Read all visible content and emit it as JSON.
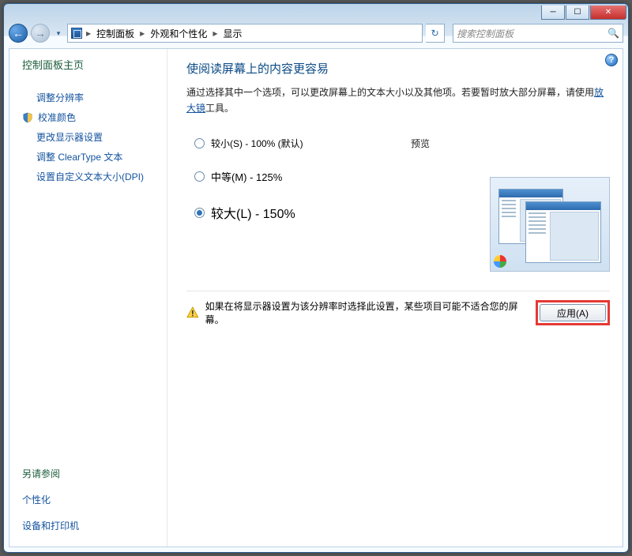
{
  "titlebar": {
    "minimize": "─",
    "maximize": "☐",
    "close": "✕"
  },
  "addressbar": {
    "nav_back": "←",
    "nav_fwd": "→",
    "segments": [
      "控制面板",
      "外观和个性化",
      "显示"
    ],
    "search_placeholder": "搜索控制面板"
  },
  "sidebar": {
    "home": "控制面板主页",
    "links": [
      {
        "label": "调整分辨率",
        "shield": false
      },
      {
        "label": "校准颜色",
        "shield": true
      },
      {
        "label": "更改显示器设置",
        "shield": false
      },
      {
        "label": "调整 ClearType 文本",
        "shield": false
      },
      {
        "label": "设置自定义文本大小(DPI)",
        "shield": false
      }
    ],
    "see_also_title": "另请参阅",
    "see_also": [
      "个性化",
      "设备和打印机"
    ]
  },
  "main": {
    "heading": "使阅读屏幕上的内容更容易",
    "desc_prefix": "通过选择其中一个选项，可以更改屏幕上的文本大小以及其他项。若要暂时放大部分屏幕，请使用",
    "desc_link": "放大镜",
    "desc_suffix": "工具。",
    "options": [
      {
        "label": "较小(S) - 100% (默认)",
        "selected": false,
        "size": "s"
      },
      {
        "label": "中等(M) - 125%",
        "selected": false,
        "size": "m"
      },
      {
        "label": "较大(L) - 150%",
        "selected": true,
        "size": "l"
      }
    ],
    "preview_label": "预览",
    "warning": "如果在将显示器设置为该分辨率时选择此设置，某些项目可能不适合您的屏幕。",
    "apply_label": "应用(A)"
  }
}
